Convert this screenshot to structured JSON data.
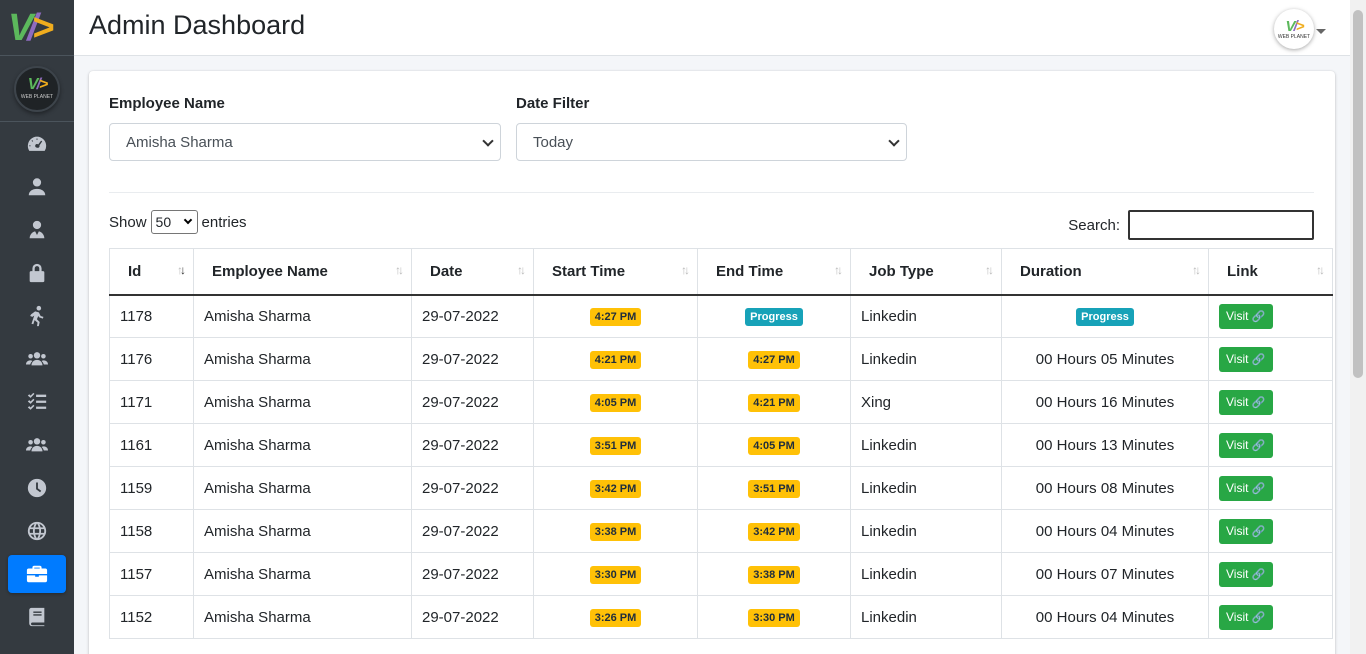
{
  "header": {
    "title": "Admin Dashboard"
  },
  "brand": {
    "name": "WEB PLANET"
  },
  "sidebar": {
    "items": [
      {
        "icon": "dashboard-icon"
      },
      {
        "icon": "user-icon"
      },
      {
        "icon": "user-tie-icon"
      },
      {
        "icon": "lock-icon"
      },
      {
        "icon": "running-person-icon"
      },
      {
        "icon": "users-icon"
      },
      {
        "icon": "task-list-icon"
      },
      {
        "icon": "team-icon"
      },
      {
        "icon": "clock-icon"
      },
      {
        "icon": "globe-icon"
      },
      {
        "icon": "briefcase-icon",
        "active": true
      },
      {
        "icon": "book-icon"
      }
    ]
  },
  "filters": {
    "employee_label": "Employee Name",
    "employee_value": "Amisha Sharma",
    "date_label": "Date Filter",
    "date_value": "Today"
  },
  "table_controls": {
    "show_label": "Show",
    "entries_value": "50",
    "entries_label": "entries",
    "search_label": "Search:"
  },
  "table": {
    "columns": [
      "Id",
      "Employee Name",
      "Date",
      "Start Time",
      "End Time",
      "Job Type",
      "Duration",
      "Link"
    ],
    "link_label": "Visit",
    "rows": [
      {
        "id": "1178",
        "name": "Amisha Sharma",
        "date": "29-07-2022",
        "start": "4:27 PM",
        "end": "Progress",
        "job": "Linkedin",
        "duration": "Progress"
      },
      {
        "id": "1176",
        "name": "Amisha Sharma",
        "date": "29-07-2022",
        "start": "4:21 PM",
        "end": "4:27 PM",
        "job": "Linkedin",
        "duration": "00 Hours 05 Minutes"
      },
      {
        "id": "1171",
        "name": "Amisha Sharma",
        "date": "29-07-2022",
        "start": "4:05 PM",
        "end": "4:21 PM",
        "job": "Xing",
        "duration": "00 Hours 16 Minutes"
      },
      {
        "id": "1161",
        "name": "Amisha Sharma",
        "date": "29-07-2022",
        "start": "3:51 PM",
        "end": "4:05 PM",
        "job": "Linkedin",
        "duration": "00 Hours 13 Minutes"
      },
      {
        "id": "1159",
        "name": "Amisha Sharma",
        "date": "29-07-2022",
        "start": "3:42 PM",
        "end": "3:51 PM",
        "job": "Linkedin",
        "duration": "00 Hours 08 Minutes"
      },
      {
        "id": "1158",
        "name": "Amisha Sharma",
        "date": "29-07-2022",
        "start": "3:38 PM",
        "end": "3:42 PM",
        "job": "Linkedin",
        "duration": "00 Hours 04 Minutes"
      },
      {
        "id": "1157",
        "name": "Amisha Sharma",
        "date": "29-07-2022",
        "start": "3:30 PM",
        "end": "3:38 PM",
        "job": "Linkedin",
        "duration": "00 Hours 07 Minutes"
      },
      {
        "id": "1152",
        "name": "Amisha Sharma",
        "date": "29-07-2022",
        "start": "3:26 PM",
        "end": "3:30 PM",
        "job": "Linkedin",
        "duration": "00 Hours 04 Minutes"
      }
    ]
  },
  "colors": {
    "sidebar_bg": "#343a40",
    "active_nav": "#007bff",
    "badge_warning": "#ffc107",
    "badge_info": "#17a2b8",
    "btn_success": "#28a745"
  }
}
